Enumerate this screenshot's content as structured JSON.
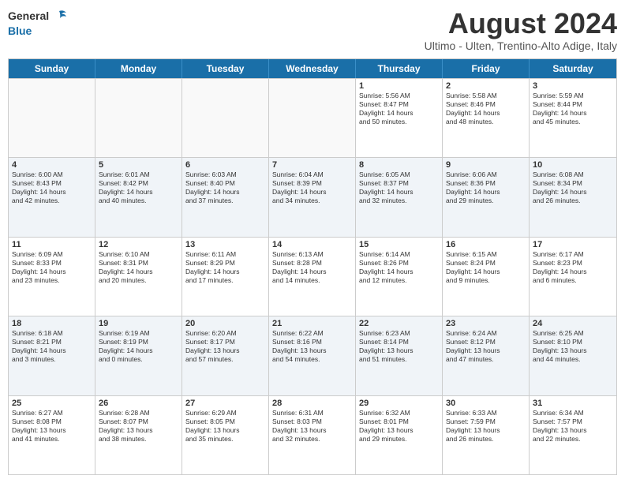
{
  "header": {
    "logo_general": "General",
    "logo_blue": "Blue",
    "month_year": "August 2024",
    "location": "Ultimo - Ulten, Trentino-Alto Adige, Italy"
  },
  "weekdays": [
    "Sunday",
    "Monday",
    "Tuesday",
    "Wednesday",
    "Thursday",
    "Friday",
    "Saturday"
  ],
  "rows": [
    [
      {
        "day": "",
        "info": "",
        "empty": true
      },
      {
        "day": "",
        "info": "",
        "empty": true
      },
      {
        "day": "",
        "info": "",
        "empty": true
      },
      {
        "day": "",
        "info": "",
        "empty": true
      },
      {
        "day": "1",
        "info": "Sunrise: 5:56 AM\nSunset: 8:47 PM\nDaylight: 14 hours\nand 50 minutes."
      },
      {
        "day": "2",
        "info": "Sunrise: 5:58 AM\nSunset: 8:46 PM\nDaylight: 14 hours\nand 48 minutes."
      },
      {
        "day": "3",
        "info": "Sunrise: 5:59 AM\nSunset: 8:44 PM\nDaylight: 14 hours\nand 45 minutes."
      }
    ],
    [
      {
        "day": "4",
        "info": "Sunrise: 6:00 AM\nSunset: 8:43 PM\nDaylight: 14 hours\nand 42 minutes."
      },
      {
        "day": "5",
        "info": "Sunrise: 6:01 AM\nSunset: 8:42 PM\nDaylight: 14 hours\nand 40 minutes."
      },
      {
        "day": "6",
        "info": "Sunrise: 6:03 AM\nSunset: 8:40 PM\nDaylight: 14 hours\nand 37 minutes."
      },
      {
        "day": "7",
        "info": "Sunrise: 6:04 AM\nSunset: 8:39 PM\nDaylight: 14 hours\nand 34 minutes."
      },
      {
        "day": "8",
        "info": "Sunrise: 6:05 AM\nSunset: 8:37 PM\nDaylight: 14 hours\nand 32 minutes."
      },
      {
        "day": "9",
        "info": "Sunrise: 6:06 AM\nSunset: 8:36 PM\nDaylight: 14 hours\nand 29 minutes."
      },
      {
        "day": "10",
        "info": "Sunrise: 6:08 AM\nSunset: 8:34 PM\nDaylight: 14 hours\nand 26 minutes."
      }
    ],
    [
      {
        "day": "11",
        "info": "Sunrise: 6:09 AM\nSunset: 8:33 PM\nDaylight: 14 hours\nand 23 minutes."
      },
      {
        "day": "12",
        "info": "Sunrise: 6:10 AM\nSunset: 8:31 PM\nDaylight: 14 hours\nand 20 minutes."
      },
      {
        "day": "13",
        "info": "Sunrise: 6:11 AM\nSunset: 8:29 PM\nDaylight: 14 hours\nand 17 minutes."
      },
      {
        "day": "14",
        "info": "Sunrise: 6:13 AM\nSunset: 8:28 PM\nDaylight: 14 hours\nand 14 minutes."
      },
      {
        "day": "15",
        "info": "Sunrise: 6:14 AM\nSunset: 8:26 PM\nDaylight: 14 hours\nand 12 minutes."
      },
      {
        "day": "16",
        "info": "Sunrise: 6:15 AM\nSunset: 8:24 PM\nDaylight: 14 hours\nand 9 minutes."
      },
      {
        "day": "17",
        "info": "Sunrise: 6:17 AM\nSunset: 8:23 PM\nDaylight: 14 hours\nand 6 minutes."
      }
    ],
    [
      {
        "day": "18",
        "info": "Sunrise: 6:18 AM\nSunset: 8:21 PM\nDaylight: 14 hours\nand 3 minutes."
      },
      {
        "day": "19",
        "info": "Sunrise: 6:19 AM\nSunset: 8:19 PM\nDaylight: 14 hours\nand 0 minutes."
      },
      {
        "day": "20",
        "info": "Sunrise: 6:20 AM\nSunset: 8:17 PM\nDaylight: 13 hours\nand 57 minutes."
      },
      {
        "day": "21",
        "info": "Sunrise: 6:22 AM\nSunset: 8:16 PM\nDaylight: 13 hours\nand 54 minutes."
      },
      {
        "day": "22",
        "info": "Sunrise: 6:23 AM\nSunset: 8:14 PM\nDaylight: 13 hours\nand 51 minutes."
      },
      {
        "day": "23",
        "info": "Sunrise: 6:24 AM\nSunset: 8:12 PM\nDaylight: 13 hours\nand 47 minutes."
      },
      {
        "day": "24",
        "info": "Sunrise: 6:25 AM\nSunset: 8:10 PM\nDaylight: 13 hours\nand 44 minutes."
      }
    ],
    [
      {
        "day": "25",
        "info": "Sunrise: 6:27 AM\nSunset: 8:08 PM\nDaylight: 13 hours\nand 41 minutes."
      },
      {
        "day": "26",
        "info": "Sunrise: 6:28 AM\nSunset: 8:07 PM\nDaylight: 13 hours\nand 38 minutes."
      },
      {
        "day": "27",
        "info": "Sunrise: 6:29 AM\nSunset: 8:05 PM\nDaylight: 13 hours\nand 35 minutes."
      },
      {
        "day": "28",
        "info": "Sunrise: 6:31 AM\nSunset: 8:03 PM\nDaylight: 13 hours\nand 32 minutes."
      },
      {
        "day": "29",
        "info": "Sunrise: 6:32 AM\nSunset: 8:01 PM\nDaylight: 13 hours\nand 29 minutes."
      },
      {
        "day": "30",
        "info": "Sunrise: 6:33 AM\nSunset: 7:59 PM\nDaylight: 13 hours\nand 26 minutes."
      },
      {
        "day": "31",
        "info": "Sunrise: 6:34 AM\nSunset: 7:57 PM\nDaylight: 13 hours\nand 22 minutes."
      }
    ]
  ]
}
